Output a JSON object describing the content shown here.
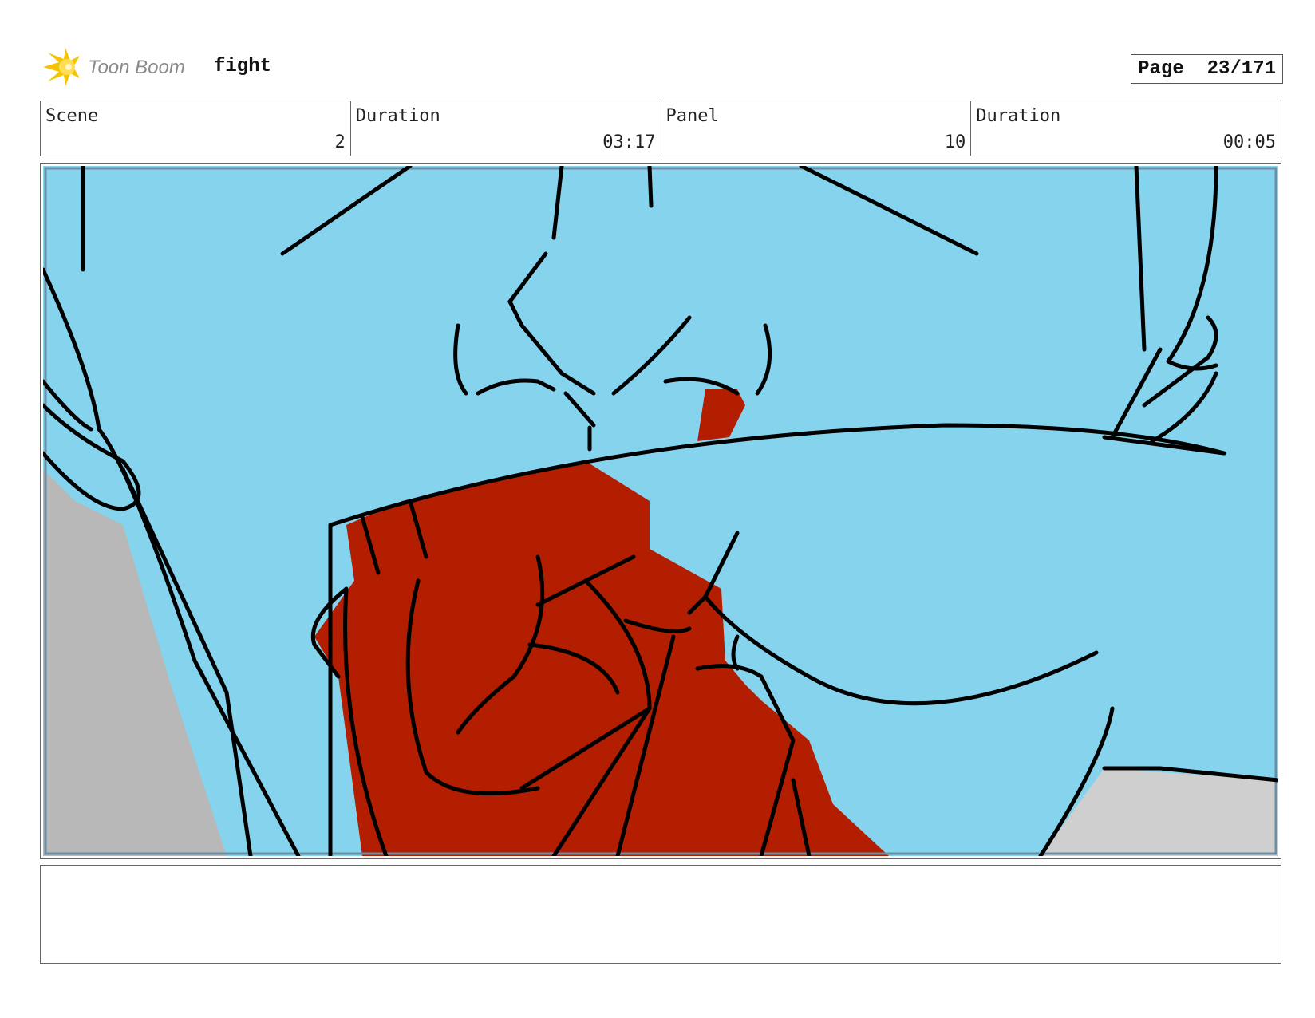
{
  "header": {
    "logo_text": "Toon Boom",
    "project_title": "fight",
    "page_label": "Page",
    "page_number": "23/171"
  },
  "info": {
    "scene_label": "Scene",
    "scene_value": "2",
    "scene_duration_label": "Duration",
    "scene_duration_value": "03:17",
    "panel_label": "Panel",
    "panel_value": "10",
    "panel_duration_label": "Duration",
    "panel_duration_value": "00:05"
  },
  "caption": {
    "text": ""
  },
  "colors": {
    "sky_blue": "#86d3ee",
    "red": "#b31e00",
    "grey": "#b8b8b8",
    "logo_yellow": "#f2c200",
    "logo_grey": "#8a8a8a"
  }
}
